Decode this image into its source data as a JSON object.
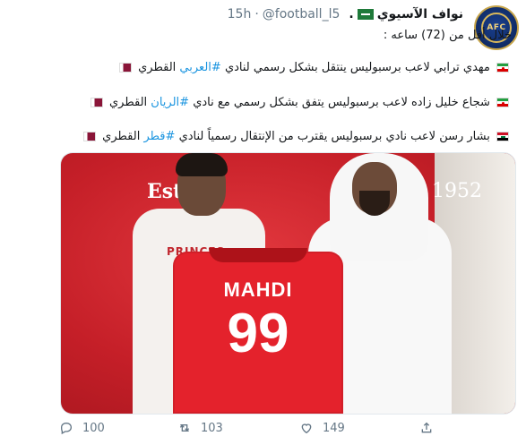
{
  "tweet": {
    "author_name": "نواف الآسيوي",
    "handle": "@football_l5",
    "separator": "·",
    "time": "15h",
    "lines": {
      "intro": "خلال أقل من (72) ساعه :",
      "l1_text": "مهدي ترابي لاعب برسبوليس ينتقل بشكل رسمي لنادي",
      "l1_hashtag": "#العربي",
      "l1_suffix": "القطري",
      "l2_text": "شجاع خليل زاده لاعب برسبوليس يتفق بشكل رسمي مع نادي",
      "l2_hashtag": "#الريان",
      "l2_suffix": "القطري",
      "l3_text": "بشار رسن لاعب نادي برسبوليس يقترب من الإنتقال رسمياً لنادي",
      "l3_hashtag": "#قطر",
      "l3_suffix": "القطري"
    }
  },
  "media": {
    "est_text": "Est",
    "year_text": "1952",
    "shirt_brand": "PRINCES",
    "jersey_name": "MAHDI",
    "jersey_number": "99"
  },
  "actions": {
    "replies": "100",
    "retweets": "103",
    "likes": "149"
  },
  "colors": {
    "hashtag": "#1b95e0",
    "meta": "#657786",
    "jersey": "#e4222c"
  },
  "icons": [
    "afc-logo",
    "saudi-flag",
    "iran-flag",
    "qatar-flag",
    "iraq-flag",
    "reply-icon",
    "retweet-icon",
    "like-icon",
    "share-icon",
    "more-icon"
  ]
}
